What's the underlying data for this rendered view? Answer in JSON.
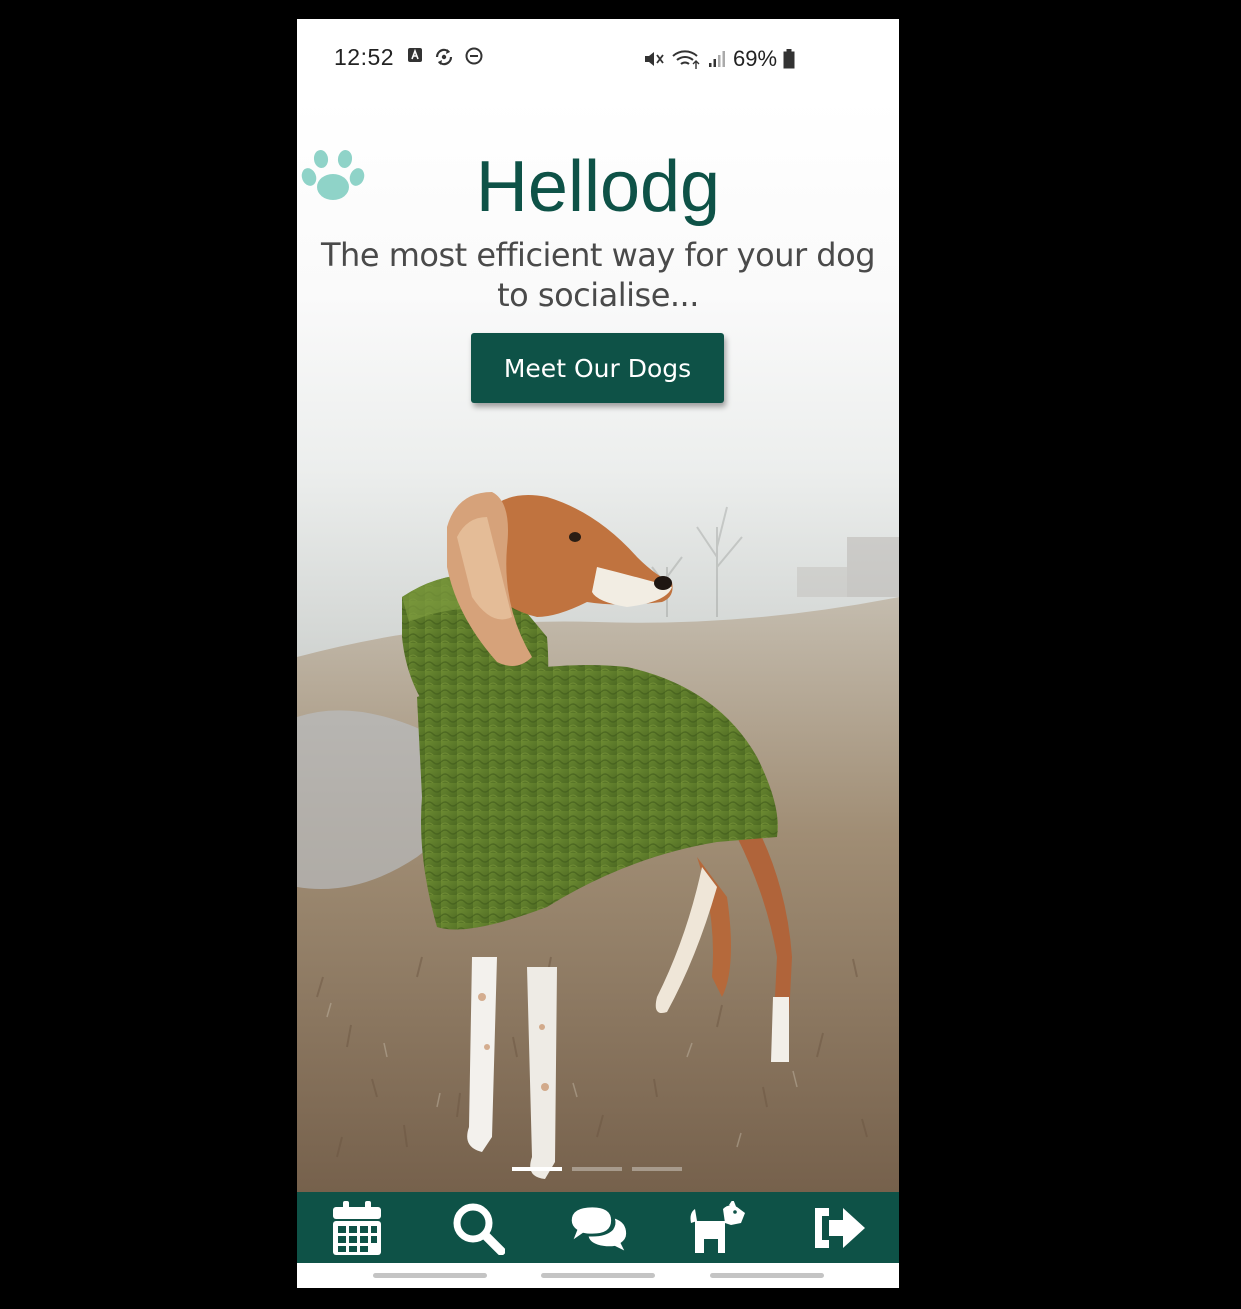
{
  "status_bar": {
    "time": "12:52",
    "battery": "69%",
    "left_icons": [
      "app-notification-icon",
      "sync-icon",
      "do-not-disturb-icon"
    ],
    "right_icons": [
      "mute-icon",
      "wifi-icon",
      "signal-icon",
      "battery-icon"
    ]
  },
  "hero": {
    "brand_before": "Hellod",
    "brand_after": "g",
    "brand_icon": "paw-icon",
    "tagline": "The most efficient way for your dog to socialise...",
    "cta_label": "Meet Our Dogs",
    "carousel_pages": 3,
    "carousel_active": 1
  },
  "nav": {
    "items": [
      {
        "icon": "calendar-icon"
      },
      {
        "icon": "search-icon"
      },
      {
        "icon": "chat-icon"
      },
      {
        "icon": "dog-icon"
      },
      {
        "icon": "logout-icon"
      }
    ]
  },
  "colors": {
    "brand": "#0e5247",
    "paw": "#8fd3c8",
    "text_gray": "#4a4a4a",
    "sweater_green": "#5e7a2a"
  }
}
